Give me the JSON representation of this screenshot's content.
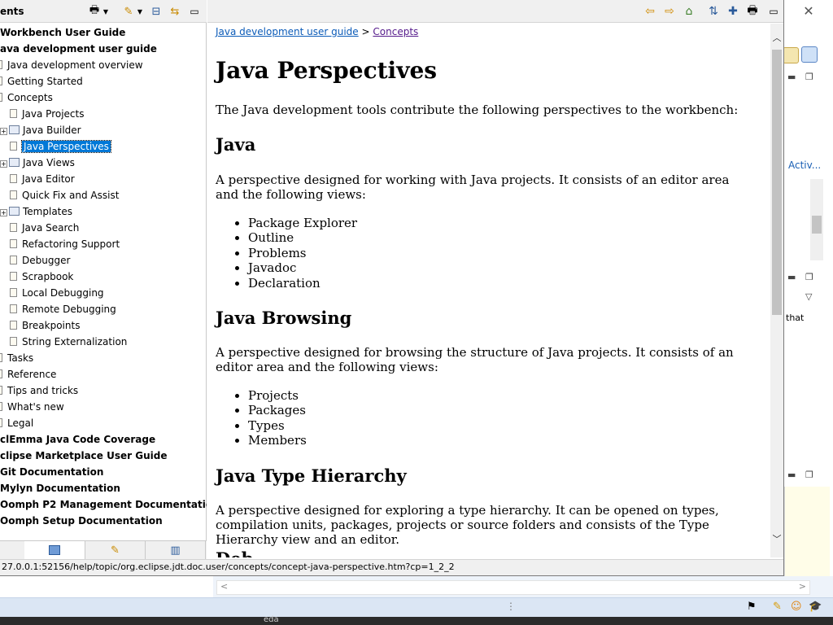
{
  "toc": {
    "title": "ents",
    "items": [
      {
        "label": "Workbench User Guide",
        "bold": true,
        "indent": 0,
        "icon": ""
      },
      {
        "label": "ava development user guide",
        "bold": true,
        "indent": 0,
        "icon": ""
      },
      {
        "label": "Java development overview",
        "indent": 1,
        "icon": "doc"
      },
      {
        "label": "Getting Started",
        "indent": 1,
        "icon": "doc"
      },
      {
        "label": "Concepts",
        "indent": 1,
        "icon": "doc"
      },
      {
        "label": "Java Projects",
        "indent": 2,
        "icon": "doc"
      },
      {
        "label": "Java Builder",
        "indent": 2,
        "icon": "book",
        "expander": "+"
      },
      {
        "label": "Java Perspectives",
        "indent": 2,
        "icon": "doc",
        "selected": true
      },
      {
        "label": "Java Views",
        "indent": 2,
        "icon": "book",
        "expander": "+"
      },
      {
        "label": "Java Editor",
        "indent": 2,
        "icon": "doc"
      },
      {
        "label": "Quick Fix and Assist",
        "indent": 2,
        "icon": "doc"
      },
      {
        "label": "Templates",
        "indent": 2,
        "icon": "book",
        "expander": "+"
      },
      {
        "label": "Java Search",
        "indent": 2,
        "icon": "doc"
      },
      {
        "label": "Refactoring Support",
        "indent": 2,
        "icon": "doc"
      },
      {
        "label": "Debugger",
        "indent": 2,
        "icon": "doc"
      },
      {
        "label": "Scrapbook",
        "indent": 2,
        "icon": "doc"
      },
      {
        "label": "Local Debugging",
        "indent": 2,
        "icon": "doc"
      },
      {
        "label": "Remote Debugging",
        "indent": 2,
        "icon": "doc"
      },
      {
        "label": "Breakpoints",
        "indent": 2,
        "icon": "doc"
      },
      {
        "label": "String Externalization",
        "indent": 2,
        "icon": "doc"
      },
      {
        "label": "Tasks",
        "indent": 1,
        "icon": "doc"
      },
      {
        "label": "Reference",
        "indent": 1,
        "icon": "doc"
      },
      {
        "label": "Tips and tricks",
        "indent": 1,
        "icon": "doc"
      },
      {
        "label": "What's new",
        "indent": 1,
        "icon": "doc"
      },
      {
        "label": "Legal",
        "indent": 1,
        "icon": "doc"
      },
      {
        "label": "clEmma Java Code Coverage",
        "bold": true,
        "indent": 0,
        "icon": ""
      },
      {
        "label": "clipse Marketplace User Guide",
        "bold": true,
        "indent": 0,
        "icon": ""
      },
      {
        "label": "Git Documentation",
        "bold": true,
        "indent": 0,
        "icon": ""
      },
      {
        "label": "Mylyn Documentation",
        "bold": true,
        "indent": 0,
        "icon": ""
      },
      {
        "label": "Oomph P2 Management Documentation",
        "bold": true,
        "indent": 0,
        "icon": ""
      },
      {
        "label": "Oomph Setup Documentation",
        "bold": true,
        "indent": 0,
        "icon": ""
      }
    ]
  },
  "breadcrumb": {
    "root": "Java development user guide",
    "separator": ">",
    "current": "Concepts"
  },
  "article": {
    "title": "Java Perspectives",
    "intro": "The Java development tools contribute the following perspectives to the workbench:",
    "java": {
      "heading": "Java",
      "text": "A perspective designed for working with Java projects. It consists of an editor area and the following views:",
      "views": [
        "Package Explorer",
        "Outline",
        "Problems",
        "Javadoc",
        "Declaration"
      ]
    },
    "browsing": {
      "heading": "Java Browsing",
      "text": "A perspective designed for browsing the structure of Java projects. It consists of an editor area and the following views:",
      "views": [
        "Projects",
        "Packages",
        "Types",
        "Members"
      ]
    },
    "hierarchy": {
      "heading": "Java Type Hierarchy",
      "text": "A perspective designed for exploring a type hierarchy. It can be opened on types, compilation units, packages, projects or source folders and consists of the Type Hierarchy view and an editor."
    },
    "next_heading_partial": "Deb"
  },
  "status": {
    "url": "27.0.0.1:52156/help/topic/org.eclipse.jdt.doc.user/concepts/concept-java-perspective.htm?cp=1_2_2"
  },
  "background": {
    "activ_label": "Activ...",
    "that_label": "that",
    "taskbar_label": "eda",
    "close_glyph": "✕"
  },
  "colors": {
    "selection": "#0078d7",
    "link": "#0b5bb8",
    "visited_link": "#551a8b",
    "toolbar": "#f0f0f0"
  },
  "icons": {
    "print": "printer-icon",
    "highlight": "highlight-search-icon",
    "collapse": "collapse-all-icon",
    "link_with": "link-with-contents-icon",
    "maximize": "maximize-icon",
    "back": "back-arrow-icon",
    "forward": "forward-arrow-icon",
    "home": "home-icon",
    "sync": "show-in-toc-icon",
    "bookmark": "bookmark-add-icon"
  }
}
